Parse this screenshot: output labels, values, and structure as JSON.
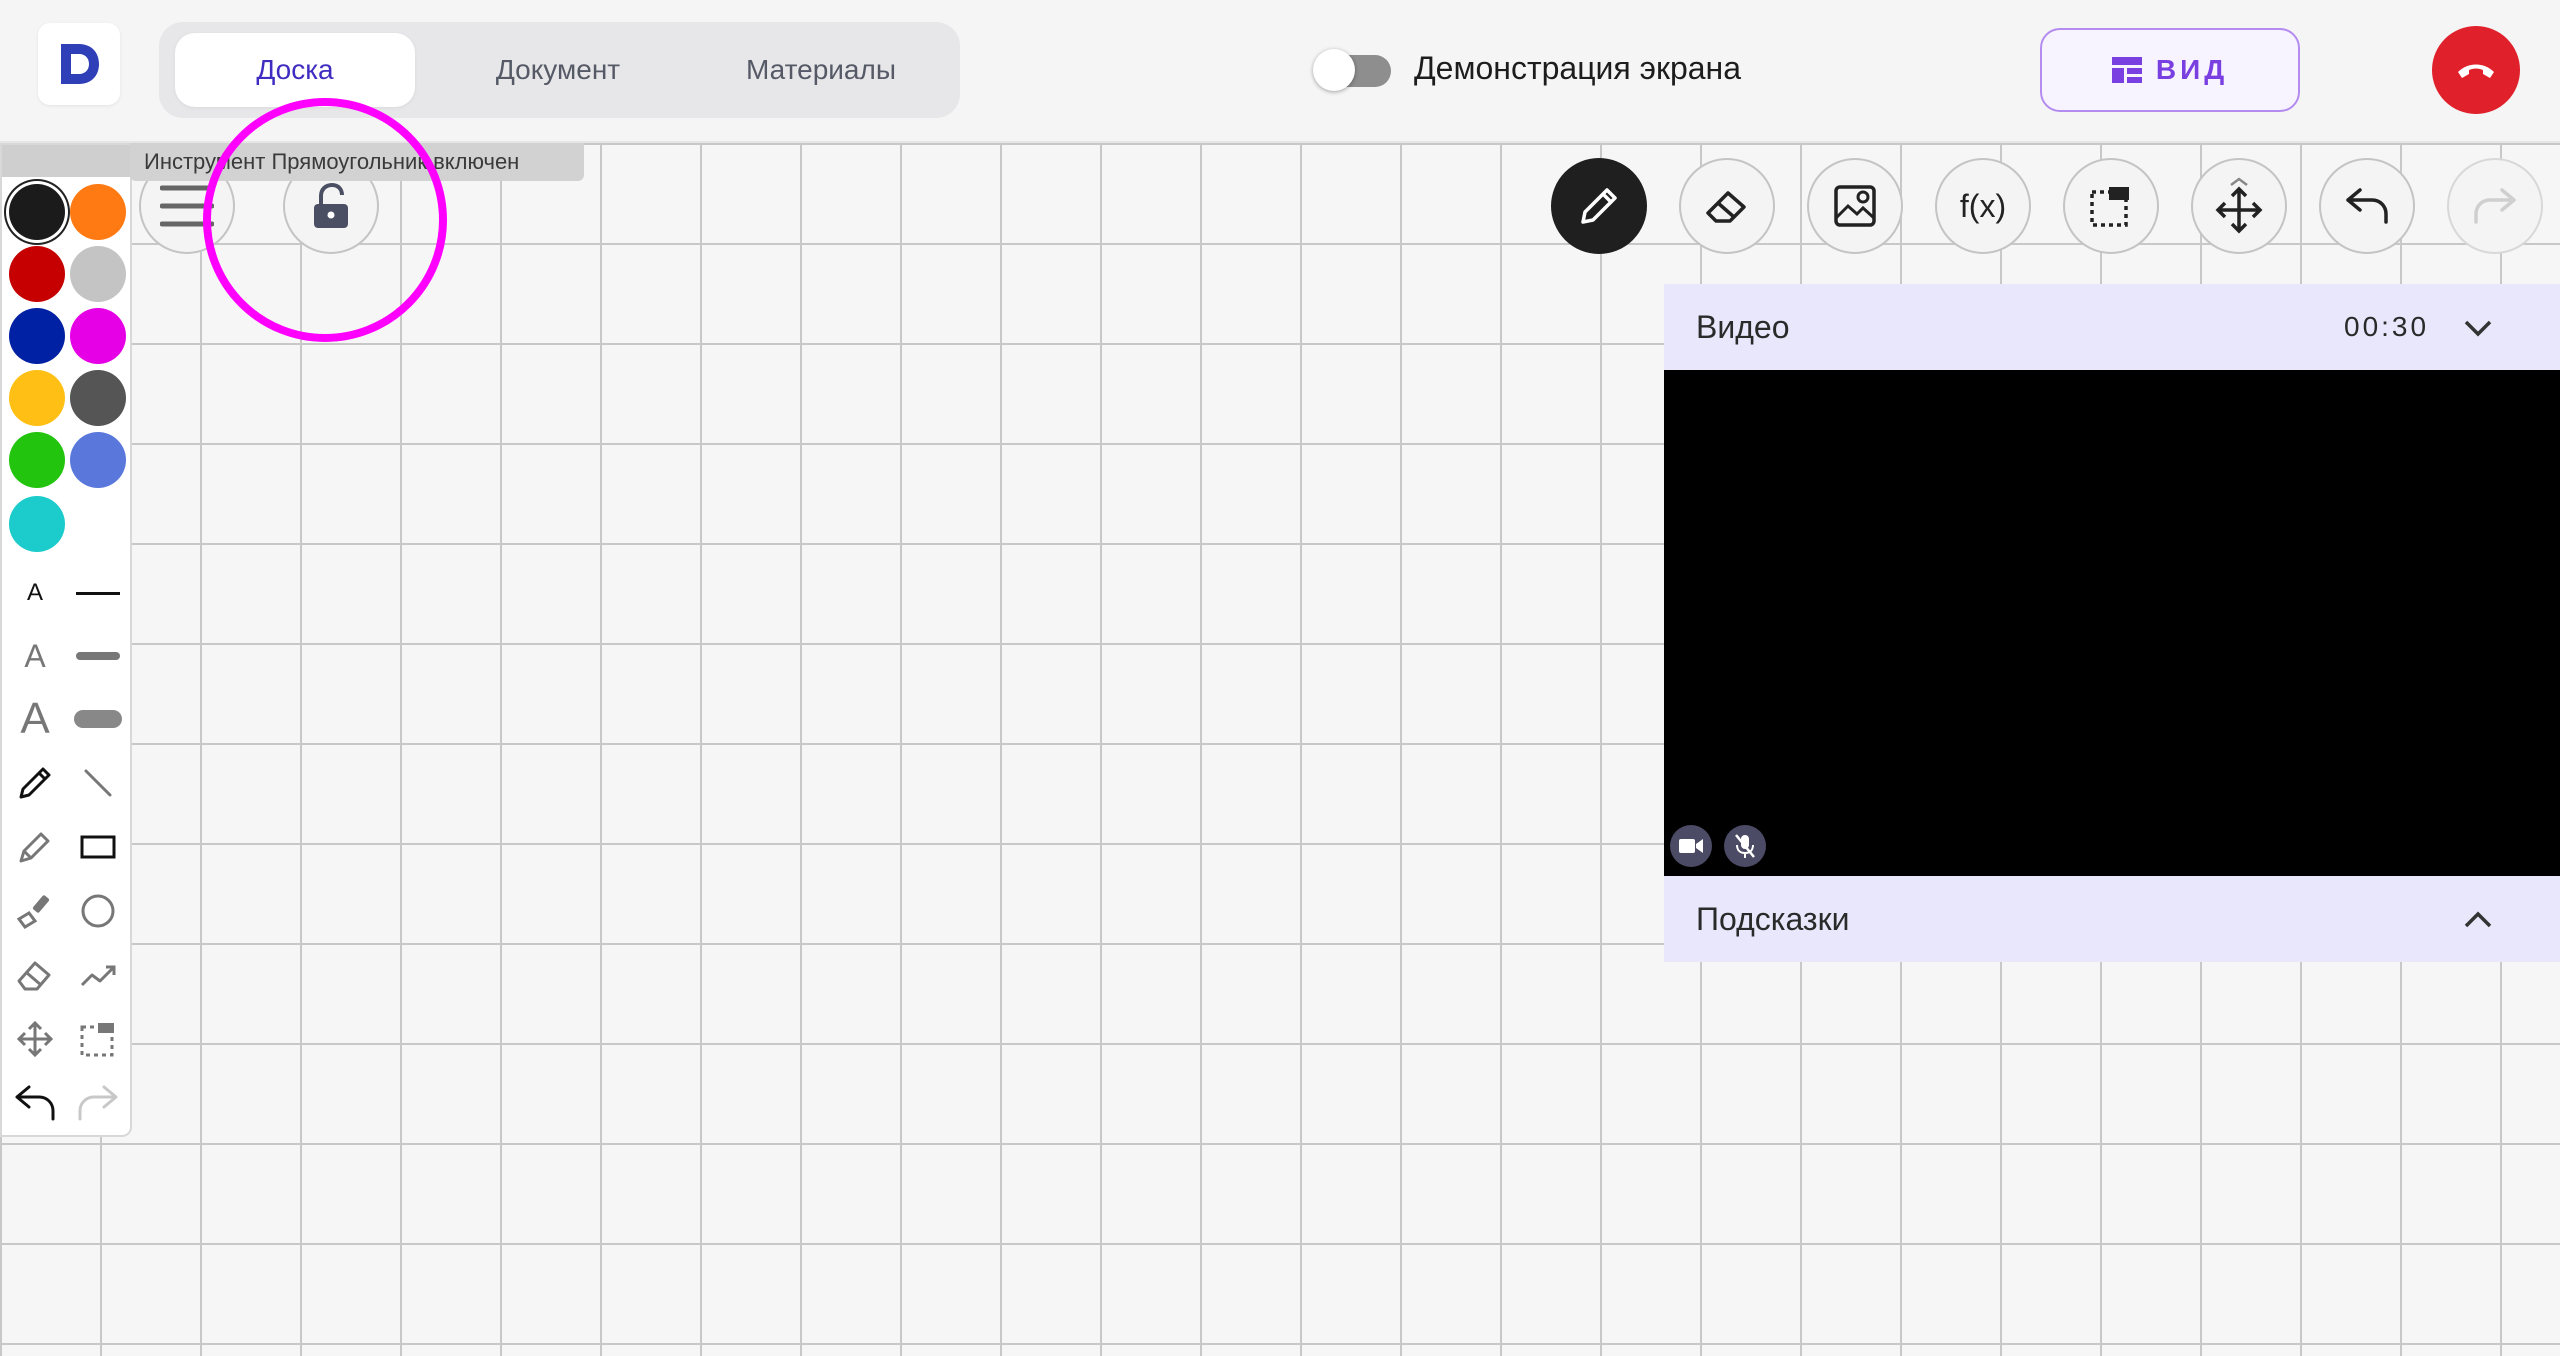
{
  "header": {
    "logo_letter": "D",
    "tabs": [
      {
        "label": "Доска",
        "active": true
      },
      {
        "label": "Документ",
        "active": false
      },
      {
        "label": "Материалы",
        "active": false
      }
    ],
    "screen_demo_label": "Демонстрация экрана",
    "screen_demo_enabled": false,
    "view_button_label": "ВИД"
  },
  "tooltip": "Инструмент Прямоугольник включен",
  "palette": {
    "colors": [
      "#1b1b1b",
      "#ff7a12",
      "#c60000",
      "#c4c4c4",
      "#0021a3",
      "#e600e6",
      "#ffbf14",
      "#555555",
      "#22c40e",
      "#5a78dc",
      "#1ccccc"
    ],
    "selected": "#1b1b1b"
  },
  "left_tools": {
    "font_sizes": [
      "A",
      "A",
      "A"
    ],
    "line_widths": [
      "thin",
      "medium",
      "thick"
    ],
    "tools": [
      "pencil",
      "line",
      "marker",
      "rectangle",
      "brush",
      "circle",
      "eraser",
      "arrow-line",
      "move",
      "select",
      "undo",
      "redo"
    ]
  },
  "top_toolbar": [
    "pencil",
    "eraser",
    "image",
    "f(x)",
    "select",
    "move",
    "undo",
    "redo"
  ],
  "function_label": "f(x)",
  "video_panel": {
    "title": "Видео",
    "time": "00:30",
    "hints_title": "Подсказки"
  },
  "colors": {
    "accent_purple": "#7a3fe0",
    "tab_active_text": "#3f2cc0",
    "end_call_red": "#e0202a",
    "highlight_magenta": "#ff00ff",
    "panel_header_bg": "#e8e7fb"
  }
}
